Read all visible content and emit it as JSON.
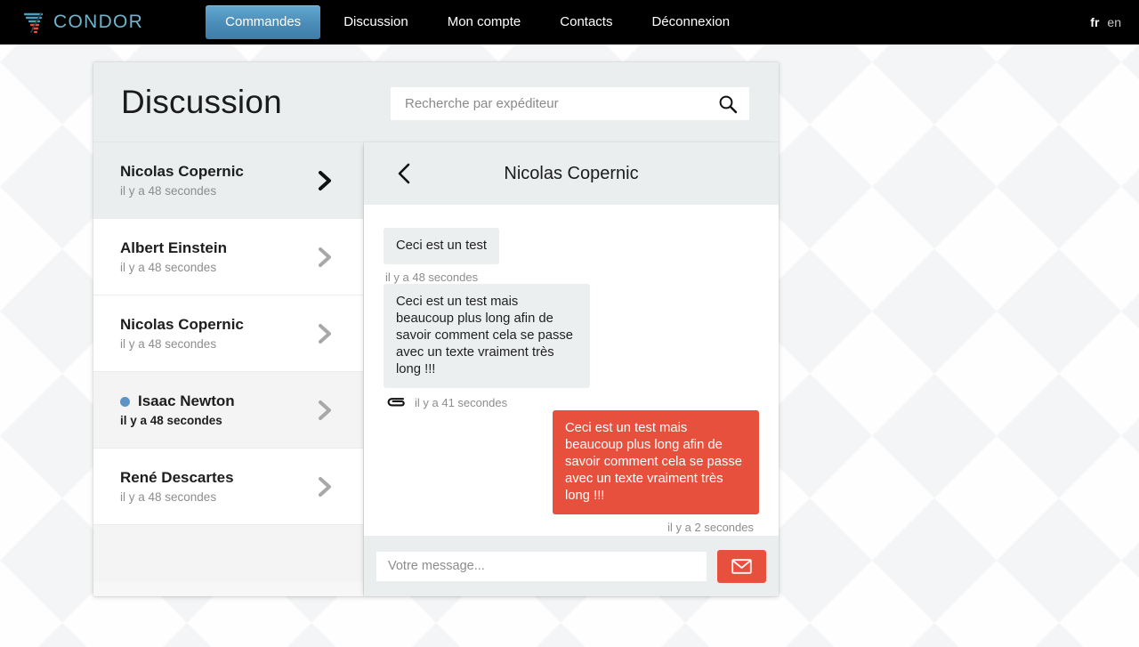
{
  "navbar": {
    "brand": "CONDOR",
    "brand_colors": {
      "top": "#4a9ec0",
      "bottom": "#e8503e"
    },
    "logo_icon": "condor-wing-icon",
    "items": [
      {
        "label": "Commandes",
        "active": true
      },
      {
        "label": "Discussion",
        "active": false
      },
      {
        "label": "Mon compte",
        "active": false
      },
      {
        "label": "Contacts",
        "active": false
      },
      {
        "label": "Déconnexion",
        "active": false
      }
    ],
    "active_accent": "#4a8cb8",
    "languages": [
      {
        "code": "fr",
        "active": true
      },
      {
        "code": "en",
        "active": false
      }
    ]
  },
  "page": {
    "title": "Discussion"
  },
  "search": {
    "placeholder": "Recherche par expéditeur",
    "value": "",
    "icon": "search-icon"
  },
  "conversations": [
    {
      "name": "Nicolas Copernic",
      "time": "il y a 48 secondes",
      "state": "selected",
      "unread": false
    },
    {
      "name": "Albert Einstein",
      "time": "il y a 48 secondes",
      "state": "normal",
      "unread": false
    },
    {
      "name": "Nicolas Copernic",
      "time": "il y a 48 secondes",
      "state": "normal",
      "unread": false
    },
    {
      "name": "Isaac Newton",
      "time": "il y a 48 secondes",
      "state": "hovered",
      "unread": true
    },
    {
      "name": "René Descartes",
      "time": "il y a 48 secondes",
      "state": "normal",
      "unread": false
    }
  ],
  "chat": {
    "back_icon": "chevron-left-icon",
    "title": "Nicolas Copernic",
    "messages": [
      {
        "text": "Ceci est un test",
        "time": "il y a 48 secondes",
        "side": "them",
        "attachment": false
      },
      {
        "text": "Ceci est un test mais beaucoup plus long afin de savoir comment cela se passe avec un texte vraiment très long !!!",
        "time": "il y a 41 secondes",
        "side": "them",
        "attachment": true,
        "attachment_icon": "paperclip-icon"
      },
      {
        "text": "Ceci est un test mais beaucoup plus long afin de savoir comment cela se passe avec un texte vraiment très long !!!",
        "time": "il y a 2 secondes",
        "side": "me",
        "attachment": false
      }
    ],
    "bubble_colors": {
      "them": "#eceff0",
      "me": "#e8503e"
    }
  },
  "composer": {
    "placeholder": "Votre message...",
    "value": "",
    "send_icon": "envelope-icon",
    "send_color": "#e8503e"
  }
}
